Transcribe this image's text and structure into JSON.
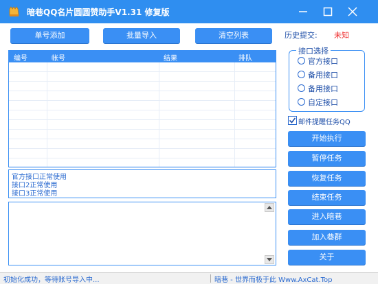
{
  "window": {
    "title": "暗巷QQ名片圆圆赞助手V1.31 修复版",
    "minimize_label": "—",
    "maximize_label": "□",
    "close_label": "✕"
  },
  "toolbar": {
    "single_add": "单号添加",
    "batch_import": "批量导入",
    "clear_list": "清空列表"
  },
  "history": {
    "label": "历史提交:",
    "value": "未知"
  },
  "table": {
    "columns": [
      "编号",
      "帐号",
      "结果",
      "排队"
    ],
    "rows": []
  },
  "interface_group": {
    "title": "接口选择",
    "options": [
      "官方接口",
      "备用接口",
      "备用接口",
      "自定接口"
    ]
  },
  "email_notify": {
    "label": "邮件提醒任务QQ",
    "checked": true
  },
  "actions": {
    "start": "开始执行",
    "pause": "暂停任务",
    "resume": "恢复任务",
    "stop": "结束任务",
    "enter": "进入暗巷",
    "join": "加入巷群",
    "about": "关于"
  },
  "log": [
    "官方接口正常使用",
    "接口2正常使用",
    "接口3正常使用"
  ],
  "status": {
    "left": "初始化成功，等待账号导入中...",
    "right": "暗巷 - 世界而极于此  Www.AxCat.Top"
  },
  "colors": {
    "accent": "#3a8ff4",
    "titlebar": "#2f8ef0",
    "warning": "#ef2b2b"
  }
}
